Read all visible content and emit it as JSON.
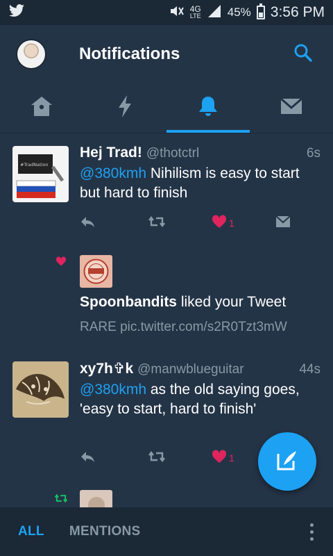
{
  "status_bar": {
    "network": "4G",
    "network_sub": "LTE",
    "battery": "45%",
    "battery_level": 0.45,
    "time": "3:56 PM"
  },
  "header": {
    "title": "Notifications"
  },
  "tabs": [
    {
      "icon": "home-icon",
      "active": false
    },
    {
      "icon": "lightning-icon",
      "active": false
    },
    {
      "icon": "bell-icon",
      "active": true
    },
    {
      "icon": "mail-icon",
      "active": false
    }
  ],
  "feed": {
    "tweet1": {
      "name": "Hej Trad!",
      "handle": "@thotctrl",
      "time": "6s",
      "mention": "@380kmh",
      "text": " Nihilism is easy to start but hard to finish",
      "avatar_caption": "#TradNation",
      "like_count": "1"
    },
    "favorite": {
      "user": "Spoonbandits",
      "action": " liked your Tweet",
      "subtext": "RARE pic.twitter.com/s2R0Tzt3mW"
    },
    "tweet2": {
      "name": "xy7h✞k",
      "handle": "@manwblueguitar",
      "time": "44s",
      "mention": "@380kmh",
      "text": " as the old saying goes, 'easy to start, hard to finish'",
      "like_count": "1"
    }
  },
  "bottom_bar": {
    "all_label": "ALL",
    "mentions_label": "MENTIONS"
  },
  "colors": {
    "accent": "#1da1f2",
    "background": "#243447",
    "bar": "#1b2836",
    "like": "#e0245e",
    "retweet": "#17bf63",
    "muted": "#8899a6"
  }
}
